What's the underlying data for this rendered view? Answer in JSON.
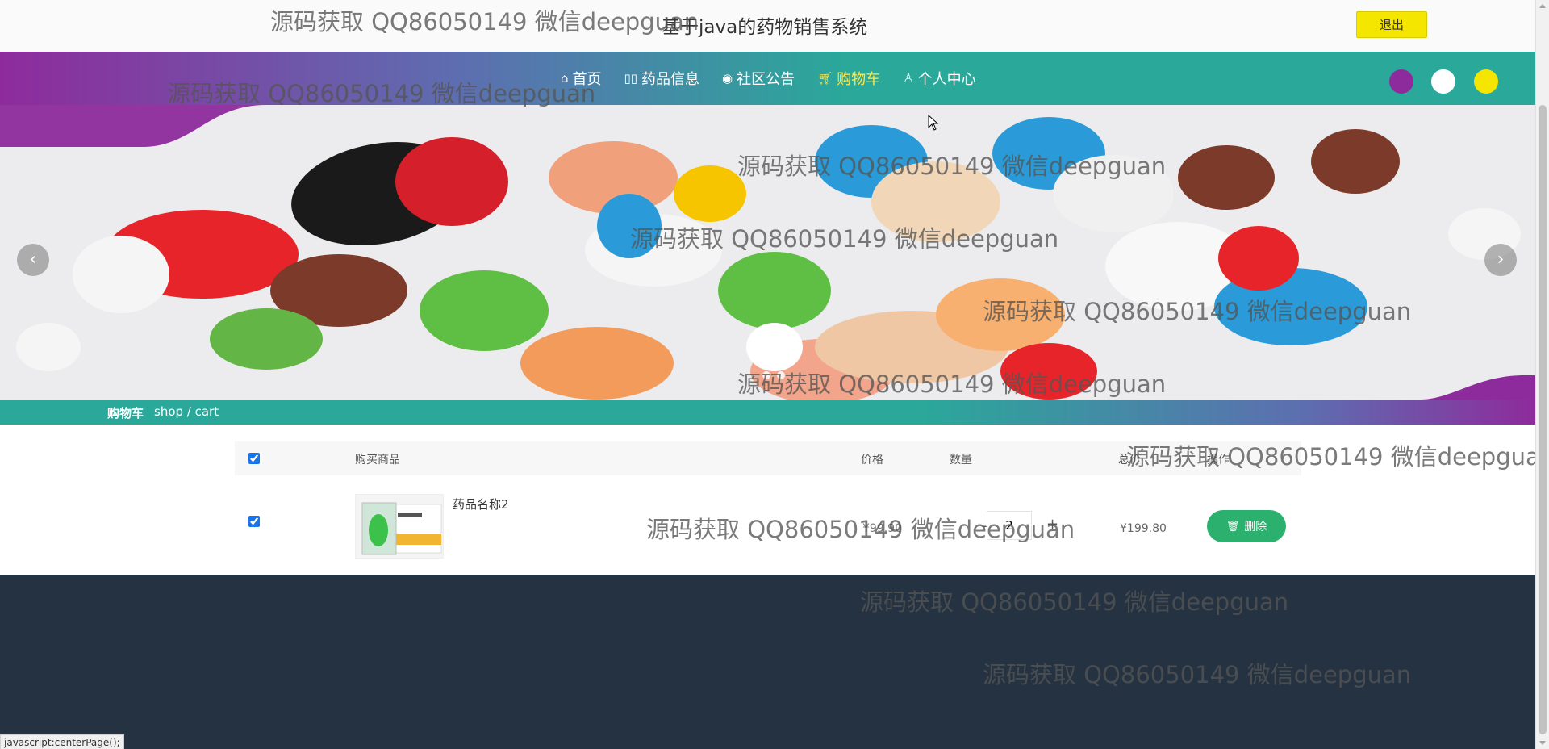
{
  "header": {
    "site_title": "基于java的药物销售系统",
    "logout_label": "退出"
  },
  "nav": {
    "items": [
      {
        "label": "首页",
        "icon": "home-icon",
        "active": false
      },
      {
        "label": "药品信息",
        "icon": "book-icon",
        "active": false
      },
      {
        "label": "社区公告",
        "icon": "bell-icon",
        "active": false
      },
      {
        "label": "购物车",
        "icon": "cart-icon",
        "active": true
      },
      {
        "label": "个人中心",
        "icon": "user-icon",
        "active": false
      }
    ],
    "theme_dots": [
      "#8e2b9c",
      "#ffffff",
      "#f5e600"
    ]
  },
  "breadcrumb": {
    "title": "购物车",
    "path": "shop / cart"
  },
  "cart": {
    "headers": {
      "product": "购买商品",
      "price": "价格",
      "quantity": "数量",
      "total": "总价",
      "action": "操作"
    },
    "items": [
      {
        "name": "药品名称2",
        "price": "¥99.90",
        "quantity": "2",
        "total": "¥199.80",
        "checked": true,
        "delete_label": "删除"
      }
    ],
    "select_all": true
  },
  "status_bar": {
    "text": "javascript:centerPage();"
  },
  "watermark": {
    "text": "源码获取 QQ86050149 微信deepguan"
  }
}
